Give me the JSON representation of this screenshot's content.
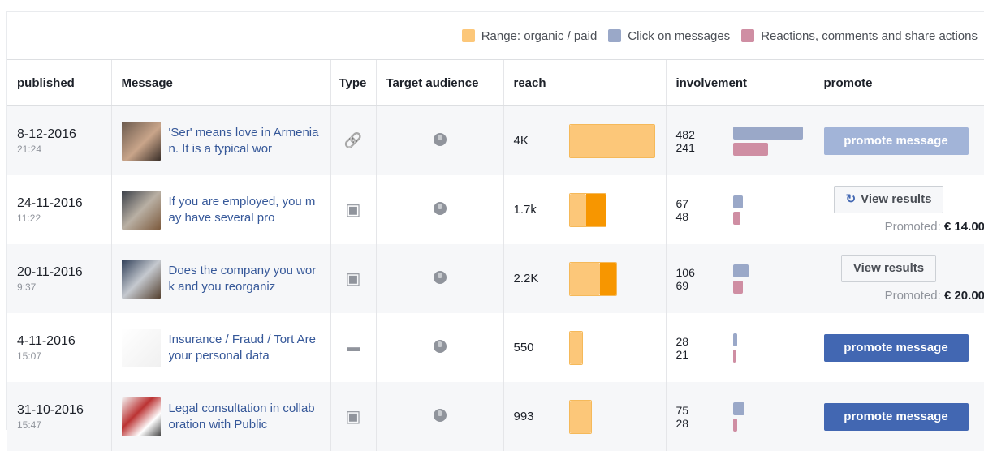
{
  "legend": {
    "range": "Range: organic / paid",
    "clicks": "Click on messages",
    "reactions": "Reactions, comments and share actions"
  },
  "colors": {
    "organic": "#fcc779",
    "paid": "#f79600",
    "clicks": "#9aa8c8",
    "reactions": "#cf8ea3",
    "button": "#4267b2"
  },
  "columns": {
    "published": "published",
    "message": "Message",
    "type": "Type",
    "target": "Target audience",
    "reach": "reach",
    "involvement": "involvement",
    "promote": "promote"
  },
  "rows": [
    {
      "date": "8-12-2016",
      "time": "21:24",
      "message": "'Ser' means love in Armenian. It is a typical wor",
      "type_icon": "link-icon",
      "reach": "4K",
      "reach_organic": 1.0,
      "reach_paid": 0.0,
      "clicks": "482",
      "reactions": "241",
      "click_fraction": 1.0,
      "react_fraction": 0.5,
      "promote_label": "promote message",
      "promote_state": "disabled"
    },
    {
      "date": "24-11-2016",
      "time": "11:22",
      "message": "If you are employed, you may have several pro",
      "type_icon": "gallery-icon",
      "reach": "1.7k",
      "reach_organic": 0.19,
      "reach_paid": 0.23,
      "clicks": "67",
      "reactions": "48",
      "click_fraction": 0.14,
      "react_fraction": 0.1,
      "view_label": "View results",
      "promoted_label": "Promoted:",
      "promoted_amount": "€ 14.00"
    },
    {
      "date": "20-11-2016",
      "time": "9:37",
      "message": "Does the company you work and you reorganiz",
      "type_icon": "gallery-icon",
      "reach": "2.2K",
      "reach_organic": 0.36,
      "reach_paid": 0.19,
      "clicks": "106",
      "reactions": "69",
      "click_fraction": 0.22,
      "react_fraction": 0.14,
      "view_label": "View results",
      "promoted_label": "Promoted:",
      "promoted_amount": "€ 20.00"
    },
    {
      "date": "4-11-2016",
      "time": "15:07",
      "message": "Insurance / Fraud / Tort Are your personal data",
      "type_icon": "comment-icon",
      "reach": "550",
      "reach_organic": 0.14,
      "reach_paid": 0.0,
      "clicks": "28",
      "reactions": "21",
      "click_fraction": 0.06,
      "react_fraction": 0.04,
      "promote_label": "promote message",
      "promote_state": "active"
    },
    {
      "date": "31-10-2016",
      "time": "15:47",
      "message": "Legal consultation in collaboration with Public",
      "type_icon": "gallery-icon",
      "reach": "993",
      "reach_organic": 0.25,
      "reach_paid": 0.0,
      "clicks": "75",
      "reactions": "28",
      "click_fraction": 0.16,
      "react_fraction": 0.06,
      "promote_label": "promote message",
      "promote_state": "active"
    }
  ]
}
